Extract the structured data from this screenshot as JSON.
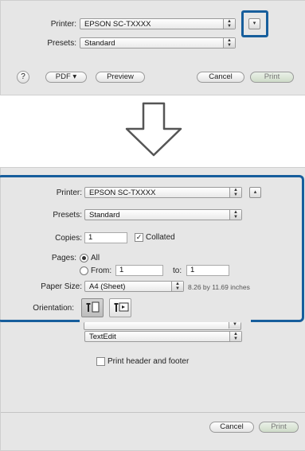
{
  "top_dialog": {
    "printer_label": "Printer:",
    "printer_value": "EPSON SC-TXXXX",
    "presets_label": "Presets:",
    "presets_value": "Standard",
    "help_glyph": "?",
    "pdf_label": "PDF ▾",
    "preview_label": "Preview",
    "cancel_label": "Cancel",
    "print_label": "Print",
    "expand_glyph": "▾"
  },
  "arrow": {
    "direction": "down",
    "color": "#b7b7b7"
  },
  "bottom_dialog": {
    "printer_label": "Printer:",
    "printer_value": "EPSON SC-TXXXX",
    "presets_label": "Presets:",
    "presets_value": "Standard",
    "collapse_glyph": "▴",
    "copies_label": "Copies:",
    "copies_value": "1",
    "collated_label": "Collated",
    "pages_label": "Pages:",
    "pages_all_label": "All",
    "pages_from_label": "From:",
    "pages_from_value": "1",
    "pages_to_label": "to:",
    "pages_to_value": "1",
    "paper_size_label": "Paper Size:",
    "paper_size_value": "A4 (Sheet)",
    "paper_dims": "8.26 by 11.69 inches",
    "orientation_label": "Orientation:",
    "hidden_popup_value": "TextEdit",
    "print_header_footer_label": "Print header and footer",
    "cancel_label": "Cancel",
    "print_label": "Print"
  },
  "colors": {
    "highlight": "#175e9c",
    "panel": "#e6e6e6"
  }
}
